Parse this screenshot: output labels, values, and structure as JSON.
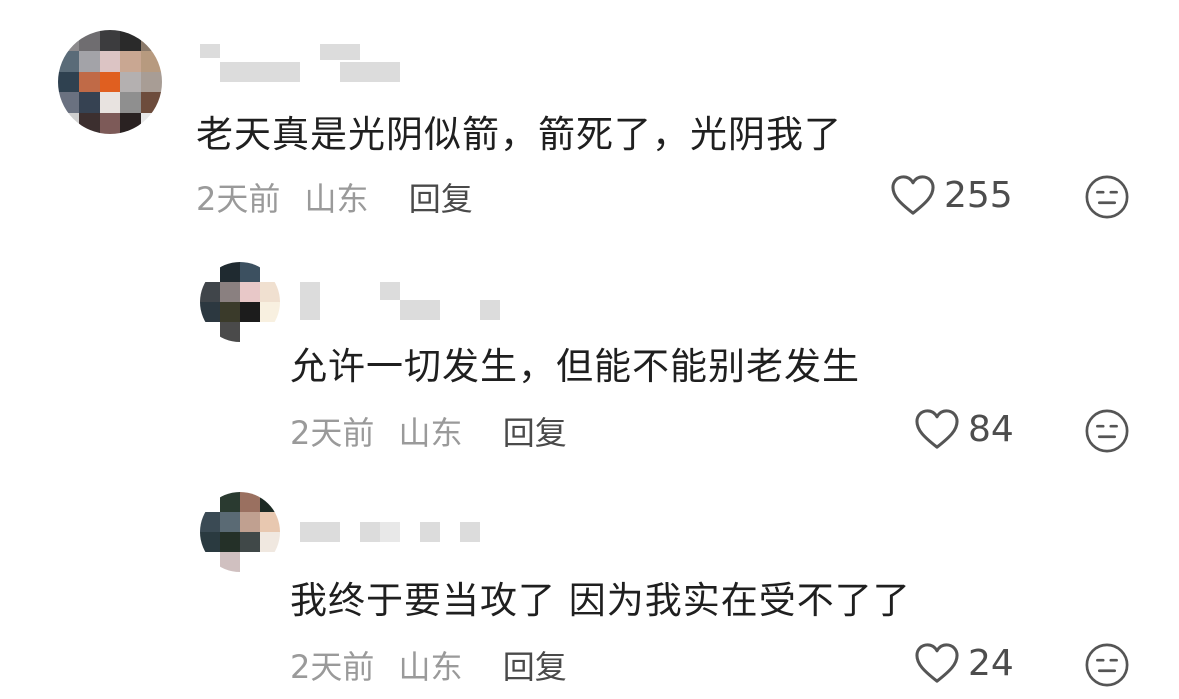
{
  "comments": [
    {
      "text": "老天真是光阴似箭，箭死了，光阴我了",
      "time": "2天前",
      "location": "山东",
      "reply_label": "回复",
      "likes": "255",
      "reply_level": 0
    },
    {
      "text": "允许一切发生，但能不能别老发生",
      "time": "2天前",
      "location": "山东",
      "reply_label": "回复",
      "likes": "84",
      "reply_level": 1
    },
    {
      "text": "我终于要当攻了 因为我实在受不了了",
      "time": "2天前",
      "location": "山东",
      "reply_label": "回复",
      "likes": "24",
      "reply_level": 1
    }
  ],
  "icons": {
    "like": "heart-outline-icon",
    "react": "neutral-face-icon"
  },
  "colors": {
    "text": "#1f1f1f",
    "meta": "#9a9a9a",
    "reply": "#4a4a4a",
    "icon": "#555555"
  }
}
